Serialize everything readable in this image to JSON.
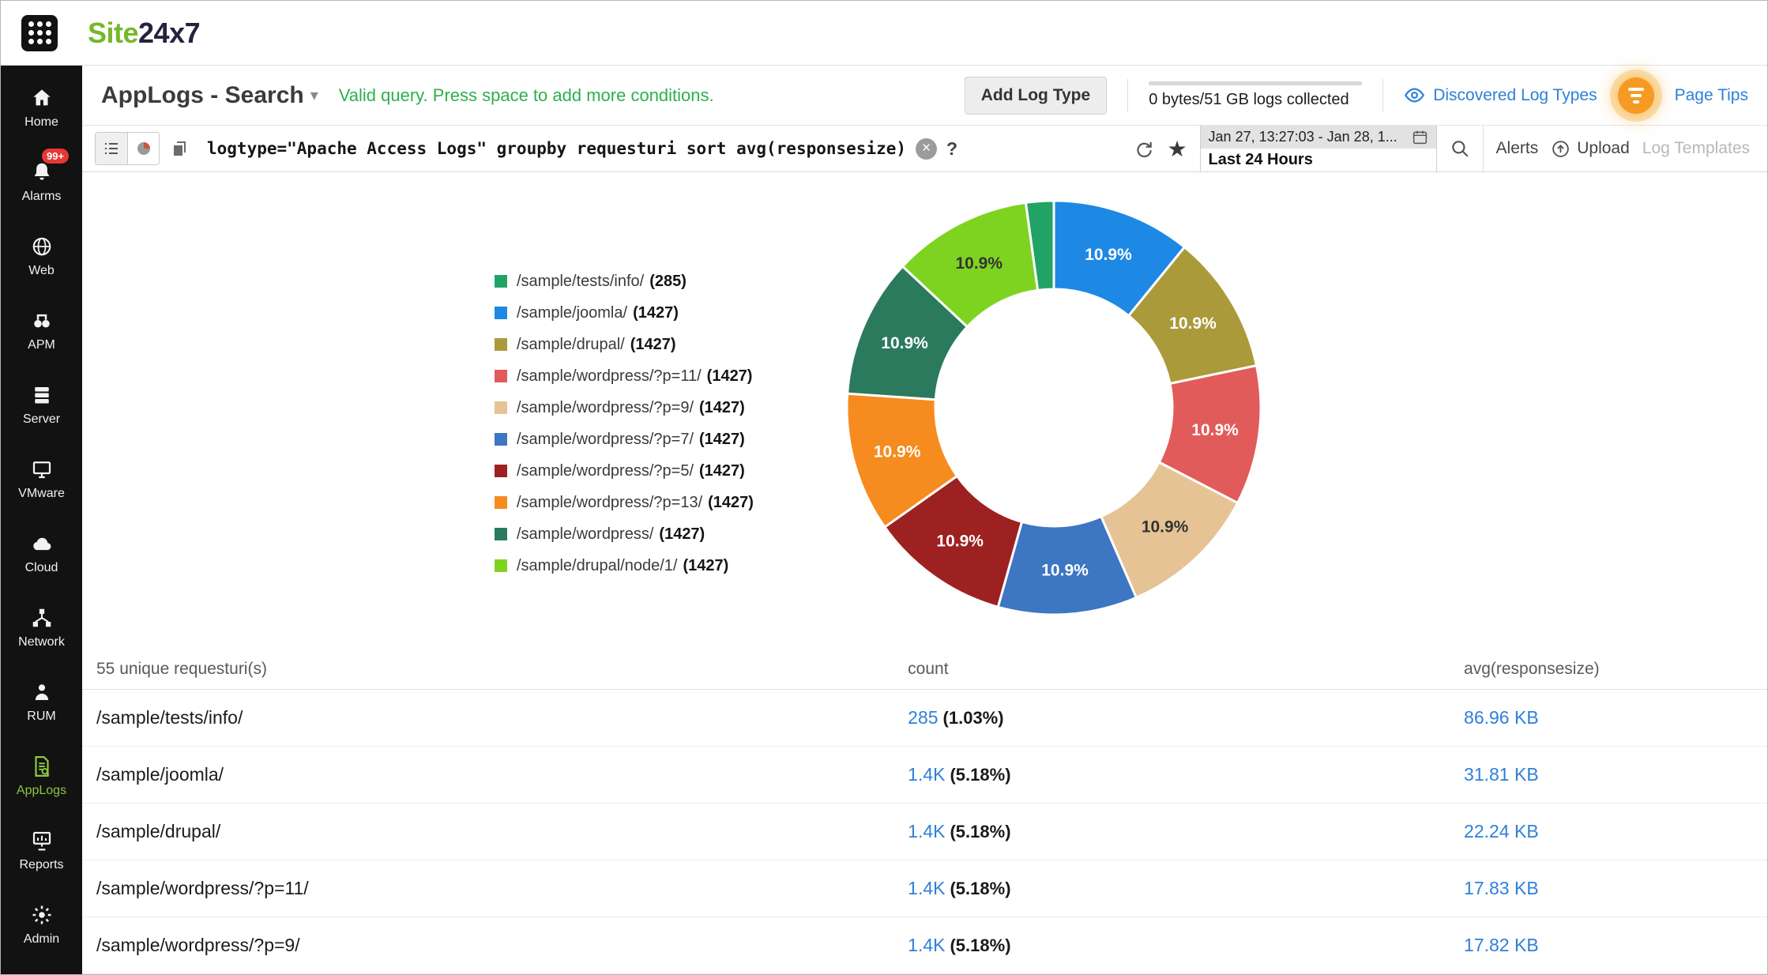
{
  "colors": {
    "brand_green": "#76b82a",
    "active_green": "#8dc63f",
    "valid_green": "#2daf4d",
    "link_blue": "#2e80d9",
    "badge_red": "#e53935",
    "tips_orange": "#f59a23"
  },
  "topbar": {
    "logo": {
      "part1": "Site",
      "part2": "24x7"
    }
  },
  "sidebar": {
    "items": [
      {
        "label": "Home",
        "icon": "home-icon"
      },
      {
        "label": "Alarms",
        "icon": "bell-icon",
        "badge": "99+"
      },
      {
        "label": "Web",
        "icon": "globe-icon"
      },
      {
        "label": "APM",
        "icon": "binoculars-icon"
      },
      {
        "label": "Server",
        "icon": "server-icon"
      },
      {
        "label": "VMware",
        "icon": "monitor-icon"
      },
      {
        "label": "Cloud",
        "icon": "cloud-icon"
      },
      {
        "label": "Network",
        "icon": "network-icon"
      },
      {
        "label": "RUM",
        "icon": "user-icon"
      },
      {
        "label": "AppLogs",
        "icon": "applogs-icon",
        "active": true
      },
      {
        "label": "Reports",
        "icon": "reports-icon"
      },
      {
        "label": "Admin",
        "icon": "gear-icon"
      }
    ]
  },
  "header": {
    "title": "AppLogs - Search",
    "validation_message": "Valid query. Press space to add more conditions.",
    "add_log_type_label": "Add Log Type",
    "logs_collected": "0 bytes/51 GB logs collected",
    "discovered_log_types_label": "Discovered Log Types",
    "page_tips_label": "Page Tips"
  },
  "querybar": {
    "query": "logtype=\"Apache Access Logs\" groupby requesturi sort avg(responsesize)",
    "help_label": "?",
    "date_range": "Jan 27, 13:27:03 - Jan 28, 1...",
    "quick_range": "Last 24 Hours",
    "alerts_label": "Alerts",
    "upload_label": "Upload",
    "log_templates_label": "Log Templates"
  },
  "chart_data": {
    "type": "pie",
    "donut": true,
    "legend_position": "left",
    "categories": [
      "/sample/tests/info/",
      "/sample/joomla/",
      "/sample/drupal/",
      "/sample/wordpress/?p=11/",
      "/sample/wordpress/?p=9/",
      "/sample/wordpress/?p=7/",
      "/sample/wordpress/?p=5/",
      "/sample/wordpress/?p=13/",
      "/sample/wordpress/",
      "/sample/drupal/node/1/"
    ],
    "values": [
      285,
      1427,
      1427,
      1427,
      1427,
      1427,
      1427,
      1427,
      1427,
      1427
    ],
    "legend_counts": [
      "(285)",
      "(1427)",
      "(1427)",
      "(1427)",
      "(1427)",
      "(1427)",
      "(1427)",
      "(1427)",
      "(1427)",
      "(1427)"
    ],
    "slice_labels": [
      "",
      "10.9%",
      "10.9%",
      "10.9%",
      "10.9%",
      "10.9%",
      "10.9%",
      "10.9%",
      "10.9%",
      "10.9%"
    ],
    "colors": [
      "#21a366",
      "#1e88e5",
      "#ab9a3a",
      "#e25b5b",
      "#e6c394",
      "#3d76c2",
      "#9e2121",
      "#f68b1f",
      "#2b7a5e",
      "#7ed321"
    ]
  },
  "table": {
    "headers": [
      "55 unique requesturi(s)",
      "count",
      "avg(responsesize)"
    ],
    "rows": [
      {
        "uri": "/sample/tests/info/",
        "count": "285",
        "pct": "(1.03%)",
        "avg": "86.96 KB"
      },
      {
        "uri": "/sample/joomla/",
        "count": "1.4K",
        "pct": "(5.18%)",
        "avg": "31.81 KB"
      },
      {
        "uri": "/sample/drupal/",
        "count": "1.4K",
        "pct": "(5.18%)",
        "avg": "22.24 KB"
      },
      {
        "uri": "/sample/wordpress/?p=11/",
        "count": "1.4K",
        "pct": "(5.18%)",
        "avg": "17.83 KB"
      },
      {
        "uri": "/sample/wordpress/?p=9/",
        "count": "1.4K",
        "pct": "(5.18%)",
        "avg": "17.82 KB"
      }
    ]
  }
}
